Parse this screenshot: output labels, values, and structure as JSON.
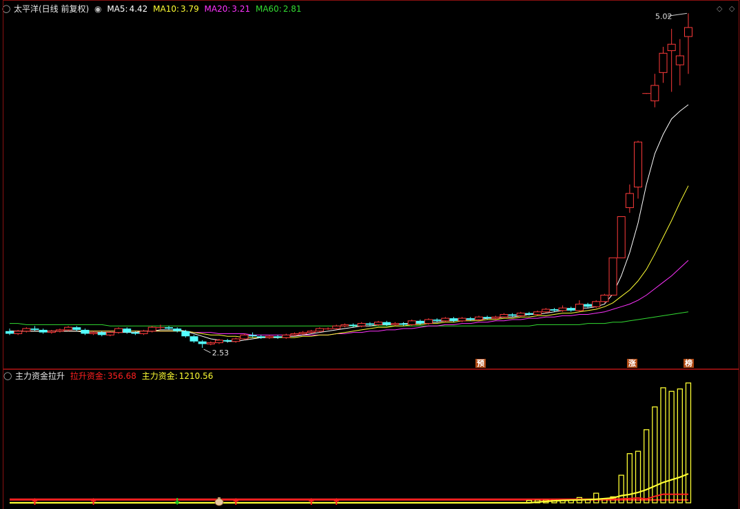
{
  "window": {
    "title": "太平洋(日线 前复权)"
  },
  "colors": {
    "up": "#ff3b3b",
    "down": "#54ffff",
    "ma5": "#ffffff",
    "ma10": "#ffff33",
    "ma20": "#ff33ff",
    "ma60": "#33dd33",
    "frame": "#8a1010",
    "lift_fund": "#ff2020",
    "main_fund": "#ffff33"
  },
  "main_panel": {
    "legend": {
      "ma5_label": "MA5:",
      "ma5_value": "4.42",
      "ma10_label": "MA10:",
      "ma10_value": "3.79",
      "ma20_label": "MA20:",
      "ma20_value": "3.21",
      "ma60_label": "MA60:",
      "ma60_value": "2.81"
    },
    "high_label": "5.02",
    "low_label": "2.53",
    "markers": [
      "预",
      "涨",
      "榜"
    ]
  },
  "sub_panel": {
    "legend": {
      "indicator_name": "主力资金拉升",
      "lift_label": "拉升资金:",
      "lift_value": "356.68",
      "main_label": "主力资金:",
      "main_value": "1210.56"
    }
  },
  "chart_data": [
    {
      "type": "candlestick",
      "title": "太平洋(日线 前复权)",
      "ylim": [
        2.45,
        5.1
      ],
      "series": [
        {
          "name": "MA5",
          "last": 4.42
        },
        {
          "name": "MA10",
          "last": 3.79
        },
        {
          "name": "MA20",
          "last": 3.21
        },
        {
          "name": "MA60",
          "last": 2.81
        }
      ],
      "candles": [
        [
          2.66,
          2.64,
          2.68,
          2.63
        ],
        [
          2.64,
          2.66,
          2.67,
          2.63
        ],
        [
          2.66,
          2.68,
          2.69,
          2.65
        ],
        [
          2.68,
          2.67,
          2.7,
          2.66
        ],
        [
          2.67,
          2.65,
          2.68,
          2.64
        ],
        [
          2.65,
          2.66,
          2.67,
          2.64
        ],
        [
          2.66,
          2.67,
          2.68,
          2.65
        ],
        [
          2.67,
          2.69,
          2.7,
          2.66
        ],
        [
          2.69,
          2.67,
          2.7,
          2.66
        ],
        [
          2.67,
          2.64,
          2.68,
          2.63
        ],
        [
          2.64,
          2.65,
          2.66,
          2.63
        ],
        [
          2.65,
          2.63,
          2.66,
          2.62
        ],
        [
          2.63,
          2.65,
          2.66,
          2.62
        ],
        [
          2.65,
          2.68,
          2.69,
          2.64
        ],
        [
          2.68,
          2.65,
          2.69,
          2.64
        ],
        [
          2.65,
          2.64,
          2.66,
          2.63
        ],
        [
          2.64,
          2.66,
          2.67,
          2.63
        ],
        [
          2.66,
          2.69,
          2.7,
          2.65
        ],
        [
          2.69,
          2.69,
          2.71,
          2.67
        ],
        [
          2.69,
          2.68,
          2.7,
          2.67
        ],
        [
          2.68,
          2.66,
          2.69,
          2.65
        ],
        [
          2.66,
          2.62,
          2.67,
          2.61
        ],
        [
          2.62,
          2.58,
          2.63,
          2.57
        ],
        [
          2.58,
          2.56,
          2.59,
          2.53
        ],
        [
          2.56,
          2.57,
          2.58,
          2.55
        ],
        [
          2.57,
          2.59,
          2.6,
          2.56
        ],
        [
          2.59,
          2.58,
          2.6,
          2.57
        ],
        [
          2.58,
          2.6,
          2.61,
          2.57
        ],
        [
          2.6,
          2.63,
          2.64,
          2.59
        ],
        [
          2.63,
          2.62,
          2.65,
          2.61
        ],
        [
          2.62,
          2.61,
          2.63,
          2.6
        ],
        [
          2.61,
          2.62,
          2.63,
          2.6
        ],
        [
          2.62,
          2.61,
          2.63,
          2.6
        ],
        [
          2.61,
          2.63,
          2.64,
          2.6
        ],
        [
          2.63,
          2.64,
          2.65,
          2.62
        ],
        [
          2.64,
          2.65,
          2.66,
          2.63
        ],
        [
          2.65,
          2.66,
          2.67,
          2.64
        ],
        [
          2.66,
          2.68,
          2.69,
          2.65
        ],
        [
          2.68,
          2.68,
          2.69,
          2.67
        ],
        [
          2.68,
          2.7,
          2.71,
          2.67
        ],
        [
          2.7,
          2.71,
          2.72,
          2.69
        ],
        [
          2.71,
          2.7,
          2.72,
          2.69
        ],
        [
          2.7,
          2.72,
          2.73,
          2.69
        ],
        [
          2.72,
          2.71,
          2.73,
          2.7
        ],
        [
          2.71,
          2.73,
          2.74,
          2.7
        ],
        [
          2.73,
          2.71,
          2.74,
          2.7
        ],
        [
          2.71,
          2.72,
          2.73,
          2.7
        ],
        [
          2.72,
          2.71,
          2.73,
          2.7
        ],
        [
          2.71,
          2.74,
          2.75,
          2.7
        ],
        [
          2.74,
          2.72,
          2.75,
          2.71
        ],
        [
          2.72,
          2.75,
          2.76,
          2.71
        ],
        [
          2.75,
          2.74,
          2.76,
          2.73
        ],
        [
          2.74,
          2.76,
          2.77,
          2.73
        ],
        [
          2.76,
          2.74,
          2.77,
          2.73
        ],
        [
          2.74,
          2.76,
          2.77,
          2.73
        ],
        [
          2.76,
          2.75,
          2.77,
          2.74
        ],
        [
          2.75,
          2.77,
          2.78,
          2.74
        ],
        [
          2.77,
          2.76,
          2.78,
          2.75
        ],
        [
          2.76,
          2.77,
          2.78,
          2.75
        ],
        [
          2.77,
          2.79,
          2.8,
          2.76
        ],
        [
          2.79,
          2.78,
          2.8,
          2.77
        ],
        [
          2.78,
          2.8,
          2.81,
          2.77
        ],
        [
          2.8,
          2.79,
          2.81,
          2.78
        ],
        [
          2.79,
          2.81,
          2.82,
          2.78
        ],
        [
          2.81,
          2.83,
          2.84,
          2.8
        ],
        [
          2.83,
          2.82,
          2.84,
          2.81
        ],
        [
          2.82,
          2.84,
          2.86,
          2.81
        ],
        [
          2.84,
          2.82,
          2.85,
          2.81
        ],
        [
          2.82,
          2.87,
          2.9,
          2.81
        ],
        [
          2.87,
          2.85,
          2.88,
          2.84
        ],
        [
          2.85,
          2.89,
          2.9,
          2.84
        ],
        [
          2.89,
          2.94,
          2.95,
          2.88
        ],
        [
          2.94,
          3.23,
          3.23,
          2.94
        ],
        [
          3.23,
          3.55,
          3.55,
          3.55
        ],
        [
          3.62,
          3.73,
          3.8,
          3.58
        ],
        [
          3.78,
          4.13,
          4.14,
          3.69
        ],
        [
          4.51,
          4.51,
          4.51,
          4.51
        ],
        [
          4.45,
          4.57,
          4.66,
          4.4
        ],
        [
          4.67,
          4.82,
          4.87,
          4.59
        ],
        [
          4.84,
          4.89,
          5.01,
          4.52
        ],
        [
          4.73,
          4.8,
          4.93,
          4.57
        ],
        [
          4.95,
          5.02,
          5.13,
          4.66
        ]
      ],
      "ma": {
        "ma5": [
          2.66,
          2.66,
          2.66,
          2.66,
          2.66,
          2.66,
          2.66,
          2.66,
          2.66,
          2.65,
          2.65,
          2.65,
          2.65,
          2.65,
          2.65,
          2.65,
          2.66,
          2.66,
          2.67,
          2.67,
          2.67,
          2.66,
          2.64,
          2.62,
          2.6,
          2.59,
          2.58,
          2.58,
          2.59,
          2.6,
          2.61,
          2.61,
          2.61,
          2.62,
          2.62,
          2.63,
          2.64,
          2.65,
          2.66,
          2.67,
          2.68,
          2.69,
          2.7,
          2.7,
          2.71,
          2.71,
          2.71,
          2.72,
          2.72,
          2.72,
          2.73,
          2.73,
          2.74,
          2.74,
          2.75,
          2.75,
          2.75,
          2.76,
          2.76,
          2.77,
          2.77,
          2.78,
          2.79,
          2.79,
          2.8,
          2.81,
          2.82,
          2.83,
          2.84,
          2.84,
          2.85,
          2.87,
          2.95,
          3.09,
          3.27,
          3.5,
          3.8,
          4.04,
          4.19,
          4.31,
          4.37,
          4.42
        ],
        "ma10": [
          2.66,
          2.66,
          2.66,
          2.66,
          2.66,
          2.66,
          2.66,
          2.66,
          2.66,
          2.66,
          2.66,
          2.66,
          2.66,
          2.66,
          2.66,
          2.66,
          2.66,
          2.66,
          2.66,
          2.66,
          2.66,
          2.66,
          2.65,
          2.64,
          2.63,
          2.63,
          2.62,
          2.62,
          2.61,
          2.61,
          2.61,
          2.61,
          2.61,
          2.61,
          2.61,
          2.62,
          2.62,
          2.63,
          2.63,
          2.64,
          2.65,
          2.66,
          2.67,
          2.68,
          2.69,
          2.69,
          2.7,
          2.7,
          2.71,
          2.71,
          2.72,
          2.72,
          2.73,
          2.73,
          2.74,
          2.74,
          2.74,
          2.75,
          2.75,
          2.76,
          2.76,
          2.77,
          2.77,
          2.78,
          2.78,
          2.79,
          2.8,
          2.8,
          2.81,
          2.82,
          2.83,
          2.85,
          2.88,
          2.93,
          2.98,
          3.05,
          3.14,
          3.26,
          3.39,
          3.52,
          3.66,
          3.79
        ],
        "ma20": [
          2.66,
          2.66,
          2.66,
          2.66,
          2.66,
          2.66,
          2.66,
          2.66,
          2.66,
          2.66,
          2.66,
          2.66,
          2.66,
          2.66,
          2.66,
          2.66,
          2.66,
          2.66,
          2.66,
          2.66,
          2.66,
          2.66,
          2.65,
          2.65,
          2.65,
          2.64,
          2.64,
          2.64,
          2.64,
          2.63,
          2.63,
          2.63,
          2.63,
          2.63,
          2.63,
          2.63,
          2.63,
          2.63,
          2.63,
          2.64,
          2.64,
          2.65,
          2.65,
          2.66,
          2.66,
          2.67,
          2.67,
          2.68,
          2.68,
          2.69,
          2.7,
          2.7,
          2.71,
          2.71,
          2.72,
          2.72,
          2.73,
          2.73,
          2.74,
          2.74,
          2.75,
          2.75,
          2.76,
          2.76,
          2.77,
          2.77,
          2.78,
          2.78,
          2.79,
          2.79,
          2.8,
          2.81,
          2.83,
          2.85,
          2.87,
          2.9,
          2.94,
          2.99,
          3.04,
          3.09,
          3.15,
          3.21
        ],
        "ma60": [
          2.72,
          2.72,
          2.71,
          2.71,
          2.71,
          2.71,
          2.71,
          2.71,
          2.71,
          2.71,
          2.71,
          2.71,
          2.7,
          2.7,
          2.7,
          2.7,
          2.7,
          2.7,
          2.7,
          2.7,
          2.7,
          2.7,
          2.7,
          2.7,
          2.7,
          2.7,
          2.7,
          2.7,
          2.7,
          2.7,
          2.7,
          2.7,
          2.7,
          2.7,
          2.7,
          2.7,
          2.7,
          2.7,
          2.7,
          2.7,
          2.7,
          2.7,
          2.7,
          2.7,
          2.7,
          2.7,
          2.7,
          2.7,
          2.7,
          2.7,
          2.7,
          2.7,
          2.7,
          2.7,
          2.7,
          2.7,
          2.7,
          2.7,
          2.7,
          2.7,
          2.7,
          2.7,
          2.7,
          2.71,
          2.71,
          2.71,
          2.71,
          2.71,
          2.71,
          2.72,
          2.72,
          2.72,
          2.73,
          2.73,
          2.74,
          2.75,
          2.76,
          2.77,
          2.78,
          2.79,
          2.8,
          2.81
        ]
      }
    },
    {
      "type": "bar",
      "title": "主力资金拉升",
      "series": [
        {
          "name": "拉升资金",
          "last": 356.68
        },
        {
          "name": "主力资金",
          "last": 1210.56
        }
      ],
      "ylim": [
        0,
        5000
      ],
      "bars": [
        {
          "index": 62,
          "value": 100
        },
        {
          "index": 63,
          "value": 120
        },
        {
          "index": 64,
          "value": 130
        },
        {
          "index": 65,
          "value": 140
        },
        {
          "index": 66,
          "value": 150
        },
        {
          "index": 67,
          "value": 130
        },
        {
          "index": 68,
          "value": 220
        },
        {
          "index": 69,
          "value": 130
        },
        {
          "index": 70,
          "value": 400
        },
        {
          "index": 71,
          "value": 150
        },
        {
          "index": 72,
          "value": 250
        },
        {
          "index": 73,
          "value": 1150
        },
        {
          "index": 74,
          "value": 2050
        },
        {
          "index": 75,
          "value": 2150
        },
        {
          "index": 76,
          "value": 3050
        },
        {
          "index": 77,
          "value": 4000
        },
        {
          "index": 78,
          "value": 4800
        },
        {
          "index": 79,
          "value": 4650
        },
        {
          "index": 80,
          "value": 4750
        },
        {
          "index": 81,
          "value": 5000
        }
      ],
      "main_line": [
        {
          "index": 0,
          "value": 0
        },
        {
          "index": 62,
          "value": 0
        },
        {
          "index": 64,
          "value": 60
        },
        {
          "index": 66,
          "value": 100
        },
        {
          "index": 68,
          "value": 120
        },
        {
          "index": 70,
          "value": 150
        },
        {
          "index": 72,
          "value": 200
        },
        {
          "index": 73,
          "value": 300
        },
        {
          "index": 74,
          "value": 350
        },
        {
          "index": 75,
          "value": 430
        },
        {
          "index": 76,
          "value": 550
        },
        {
          "index": 77,
          "value": 700
        },
        {
          "index": 78,
          "value": 850
        },
        {
          "index": 79,
          "value": 960
        },
        {
          "index": 80,
          "value": 1070
        },
        {
          "index": 81,
          "value": 1210.56
        }
      ],
      "lift_line": [
        {
          "index": 0,
          "value": 150
        },
        {
          "index": 72,
          "value": 150
        },
        {
          "index": 73,
          "value": 160
        },
        {
          "index": 74,
          "value": 180
        },
        {
          "index": 75,
          "value": 200
        },
        {
          "index": 76,
          "value": 160
        },
        {
          "index": 77,
          "value": 270
        },
        {
          "index": 78,
          "value": 360
        },
        {
          "index": 79,
          "value": 356.68
        },
        {
          "index": 80,
          "value": 356.68
        },
        {
          "index": 81,
          "value": 356.68
        }
      ],
      "arrows": [
        {
          "index": 3,
          "dir": "up"
        },
        {
          "index": 10,
          "dir": "up"
        },
        {
          "index": 20,
          "dir": "down"
        },
        {
          "index": 27,
          "dir": "up"
        },
        {
          "index": 36,
          "dir": "up"
        },
        {
          "index": 39,
          "dir": "up"
        }
      ],
      "bag_index": 25
    }
  ]
}
